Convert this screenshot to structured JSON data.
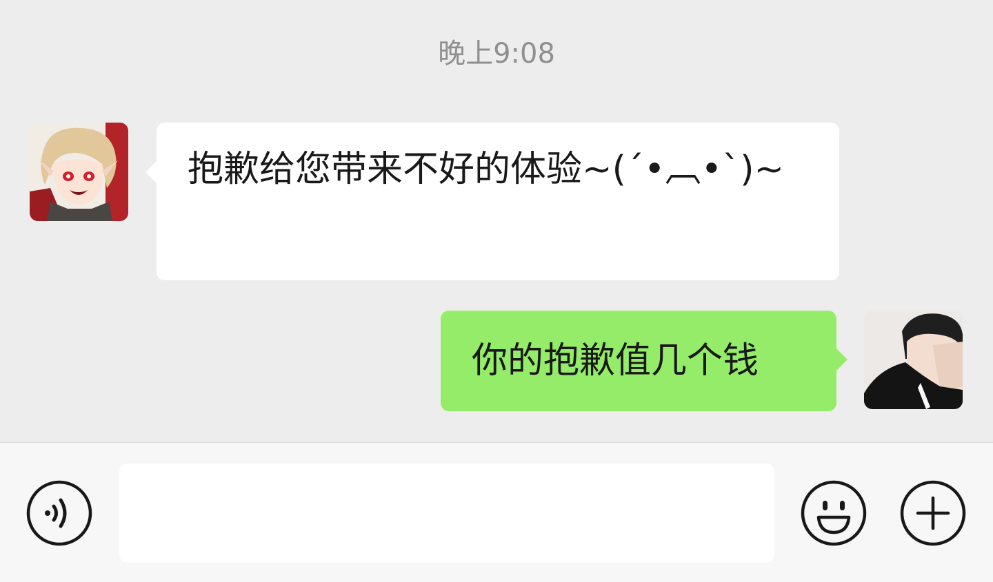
{
  "chat": {
    "timestamp": "晚上9:08",
    "messages": [
      {
        "direction": "incoming",
        "sender_avatar": "anime-elf-girl-avatar",
        "text": "抱歉给您带来不好的体验~(ˊ•︹•ˋ)~",
        "bubble_color": "#ffffff"
      },
      {
        "direction": "outgoing",
        "sender_avatar": "user-photo-avatar",
        "text": "你的抱歉值几个钱",
        "bubble_color": "#95ec69"
      }
    ]
  },
  "input_bar": {
    "voice_icon": "voice-icon",
    "text_value": "",
    "emoji_icon": "emoji-icon",
    "more_icon": "plus-icon"
  },
  "colors": {
    "background": "#ededed",
    "incoming_bubble": "#ffffff",
    "outgoing_bubble": "#95ec69",
    "timestamp_text": "#8f8f8f"
  }
}
